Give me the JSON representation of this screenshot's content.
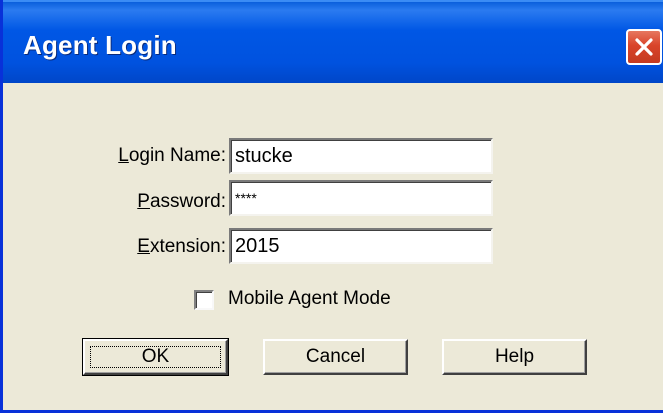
{
  "window": {
    "title": "Agent Login"
  },
  "form": {
    "login_name_label_accel": "L",
    "login_name_label_rest": "ogin Name:",
    "login_name_value": "stucke",
    "password_label_accel": "P",
    "password_label_rest": "assword:",
    "password_value": "****",
    "extension_label_accel": "E",
    "extension_label_rest": "xtension:",
    "extension_value": "2015",
    "mobile_agent_label": "Mobile Agent Mode",
    "mobile_agent_checked": false
  },
  "buttons": {
    "ok": "OK",
    "cancel": "Cancel",
    "help": "Help"
  },
  "colors": {
    "titlebar": "#0052DF",
    "dialog_bg": "#ECE9D8",
    "close_red": "#D9442A"
  },
  "icons": {
    "close": "close-icon"
  }
}
